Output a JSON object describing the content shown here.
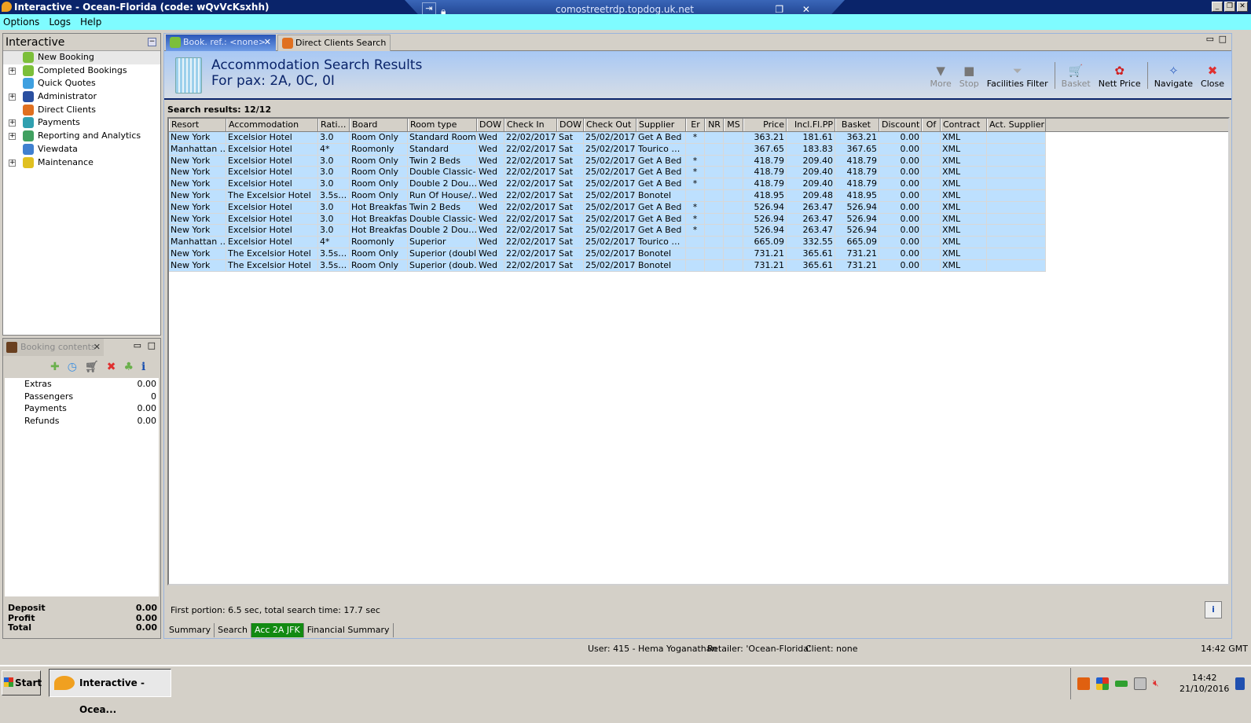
{
  "window": {
    "title": "Interactive - Ocean-Florida (code: wQvVcKsxhh)",
    "rdp_host": "comostreetrdp.topdog.uk.net"
  },
  "menu": [
    "Options",
    "Logs",
    "Help"
  ],
  "nav": {
    "title": "Interactive",
    "items": [
      {
        "label": "New Booking",
        "expandable": false,
        "icon": "palm-tree-icon",
        "color": "#7cbf3a"
      },
      {
        "label": "Completed Bookings",
        "expandable": true,
        "icon": "palm-tree-icon",
        "color": "#7cbf3a"
      },
      {
        "label": "Quick Quotes",
        "expandable": false,
        "icon": "clock-icon",
        "color": "#3fa0e0"
      },
      {
        "label": "Administrator",
        "expandable": true,
        "icon": "person-icon",
        "color": "#2a4fa0"
      },
      {
        "label": "Direct Clients",
        "expandable": false,
        "icon": "client-icon",
        "color": "#e07020"
      },
      {
        "label": "Payments",
        "expandable": true,
        "icon": "payments-icon",
        "color": "#30a0b0"
      },
      {
        "label": "Reporting and Analytics",
        "expandable": true,
        "icon": "report-icon",
        "color": "#40a060"
      },
      {
        "label": "Viewdata",
        "expandable": false,
        "icon": "globe-icon",
        "color": "#4080d0"
      },
      {
        "label": "Maintenance",
        "expandable": true,
        "icon": "maintenance-icon",
        "color": "#e0c020"
      }
    ]
  },
  "booking": {
    "tab_label": "Booking contents",
    "rows": [
      {
        "label": "Extras",
        "value": "0.00"
      },
      {
        "label": "Passengers",
        "value": "0"
      },
      {
        "label": "Payments",
        "value": "0.00"
      },
      {
        "label": "Refunds",
        "value": "0.00"
      }
    ],
    "totals": [
      {
        "label": "Deposit",
        "value": "0.00"
      },
      {
        "label": "Profit",
        "value": "0.00"
      },
      {
        "label": "Total",
        "value": "0.00"
      }
    ]
  },
  "tabs": [
    {
      "label": "Book. ref.: <none>"
    },
    {
      "label": "Direct Clients Search"
    }
  ],
  "header": {
    "title": "Accommodation Search Results",
    "subtitle": "For pax: 2A, 0C, 0I"
  },
  "toolbar": [
    {
      "label": "More",
      "glyph": "▼",
      "enabled": false
    },
    {
      "label": "Stop",
      "glyph": "■",
      "enabled": false
    },
    {
      "label": "Facilities Filter",
      "glyph": "⏷",
      "enabled": true
    },
    {
      "label": "Basket",
      "glyph": "🛒",
      "enabled": false
    },
    {
      "label": "Nett Price",
      "glyph": "✿",
      "enabled": true
    },
    {
      "label": "Navigate",
      "glyph": "✧",
      "enabled": true
    },
    {
      "label": "Close",
      "glyph": "✖",
      "enabled": true
    }
  ],
  "results_label": "Search results: 12/12",
  "columns": [
    "Resort",
    "Accommodation",
    "Rati…",
    "Board",
    "Room type",
    "DOW",
    "Check In",
    "DOW",
    "Check Out",
    "Supplier",
    "Er",
    "NR",
    "MS",
    "Price",
    "Incl.Fl.PP",
    "Basket",
    "Discount",
    "Of",
    "Contract",
    "Act. Supplier"
  ],
  "rows": [
    [
      "New York",
      "Excelsior Hotel",
      "3.0",
      "Room Only",
      "Standard Room",
      "Wed",
      "22/02/2017",
      "Sat",
      "25/02/2017",
      "Get A Bed",
      "*",
      "",
      "",
      "363.21",
      "181.61",
      "363.21",
      "0.00",
      "",
      "XML",
      ""
    ],
    [
      "Manhattan …",
      "Excelsior Hotel",
      "4*",
      "Roomonly",
      "Standard",
      "Wed",
      "22/02/2017",
      "Sat",
      "25/02/2017",
      "Tourico …",
      "",
      "",
      "",
      "367.65",
      "183.83",
      "367.65",
      "0.00",
      "",
      "XML",
      ""
    ],
    [
      "New York",
      "Excelsior Hotel",
      "3.0",
      "Room Only",
      "Twin 2 Beds",
      "Wed",
      "22/02/2017",
      "Sat",
      "25/02/2017",
      "Get A Bed",
      "*",
      "",
      "",
      "418.79",
      "209.40",
      "418.79",
      "0.00",
      "",
      "XML",
      ""
    ],
    [
      "New York",
      "Excelsior Hotel",
      "3.0",
      "Room Only",
      "Double Classic-…",
      "Wed",
      "22/02/2017",
      "Sat",
      "25/02/2017",
      "Get A Bed",
      "*",
      "",
      "",
      "418.79",
      "209.40",
      "418.79",
      "0.00",
      "",
      "XML",
      ""
    ],
    [
      "New York",
      "Excelsior Hotel",
      "3.0",
      "Room Only",
      "Double 2  Dou…",
      "Wed",
      "22/02/2017",
      "Sat",
      "25/02/2017",
      "Get A Bed",
      "*",
      "",
      "",
      "418.79",
      "209.40",
      "418.79",
      "0.00",
      "",
      "XML",
      ""
    ],
    [
      "New York",
      "The Excelsior Hotel",
      "3.5s…",
      "Room Only",
      "Run Of House/…",
      "Wed",
      "22/02/2017",
      "Sat",
      "25/02/2017",
      "Bonotel",
      "",
      "",
      "",
      "418.95",
      "209.48",
      "418.95",
      "0.00",
      "",
      "XML",
      ""
    ],
    [
      "New York",
      "Excelsior Hotel",
      "3.0",
      "Hot Breakfast",
      "Twin 2 Beds",
      "Wed",
      "22/02/2017",
      "Sat",
      "25/02/2017",
      "Get A Bed",
      "*",
      "",
      "",
      "526.94",
      "263.47",
      "526.94",
      "0.00",
      "",
      "XML",
      ""
    ],
    [
      "New York",
      "Excelsior Hotel",
      "3.0",
      "Hot Breakfast",
      "Double Classic-…",
      "Wed",
      "22/02/2017",
      "Sat",
      "25/02/2017",
      "Get A Bed",
      "*",
      "",
      "",
      "526.94",
      "263.47",
      "526.94",
      "0.00",
      "",
      "XML",
      ""
    ],
    [
      "New York",
      "Excelsior Hotel",
      "3.0",
      "Hot Breakfast",
      "Double 2  Dou…",
      "Wed",
      "22/02/2017",
      "Sat",
      "25/02/2017",
      "Get A Bed",
      "*",
      "",
      "",
      "526.94",
      "263.47",
      "526.94",
      "0.00",
      "",
      "XML",
      ""
    ],
    [
      "Manhattan …",
      "Excelsior Hotel",
      "4*",
      "Roomonly",
      "Superior",
      "Wed",
      "22/02/2017",
      "Sat",
      "25/02/2017",
      "Tourico …",
      "",
      "",
      "",
      "665.09",
      "332.55",
      "665.09",
      "0.00",
      "",
      "XML",
      ""
    ],
    [
      "New York",
      "The Excelsior Hotel",
      "3.5s…",
      "Room Only",
      "Superior (double)",
      "Wed",
      "22/02/2017",
      "Sat",
      "25/02/2017",
      "Bonotel",
      "",
      "",
      "",
      "731.21",
      "365.61",
      "731.21",
      "0.00",
      "",
      "XML",
      ""
    ],
    [
      "New York",
      "The Excelsior Hotel",
      "3.5s…",
      "Room Only",
      "Superior (doub…",
      "Wed",
      "22/02/2017",
      "Sat",
      "25/02/2017",
      "Bonotel",
      "",
      "",
      "",
      "731.21",
      "365.61",
      "731.21",
      "0.00",
      "",
      "XML",
      ""
    ]
  ],
  "timing": "First portion: 6.5 sec, total search time: 17.7 sec",
  "subtabs": [
    {
      "label": "Summary"
    },
    {
      "label": "Search"
    },
    {
      "label": "Acc 2A JFK",
      "active": true
    },
    {
      "label": "Financial Summary"
    }
  ],
  "status": {
    "user": "User: 415 - Hema Yoganathan",
    "retailer": "Retailer: 'Ocean-Florida'",
    "client": "Client: none",
    "time": "14:42 GMT"
  },
  "taskbar": {
    "start": "Start",
    "app": "Interactive - Ocea...",
    "clock_time": "14:42",
    "clock_date": "21/10/2016"
  },
  "colors": {
    "row_bg": "#bde0fe",
    "active_subtab": "#128a12",
    "title_bar": "#0a246a",
    "menu_bg": "#7ffcff"
  }
}
